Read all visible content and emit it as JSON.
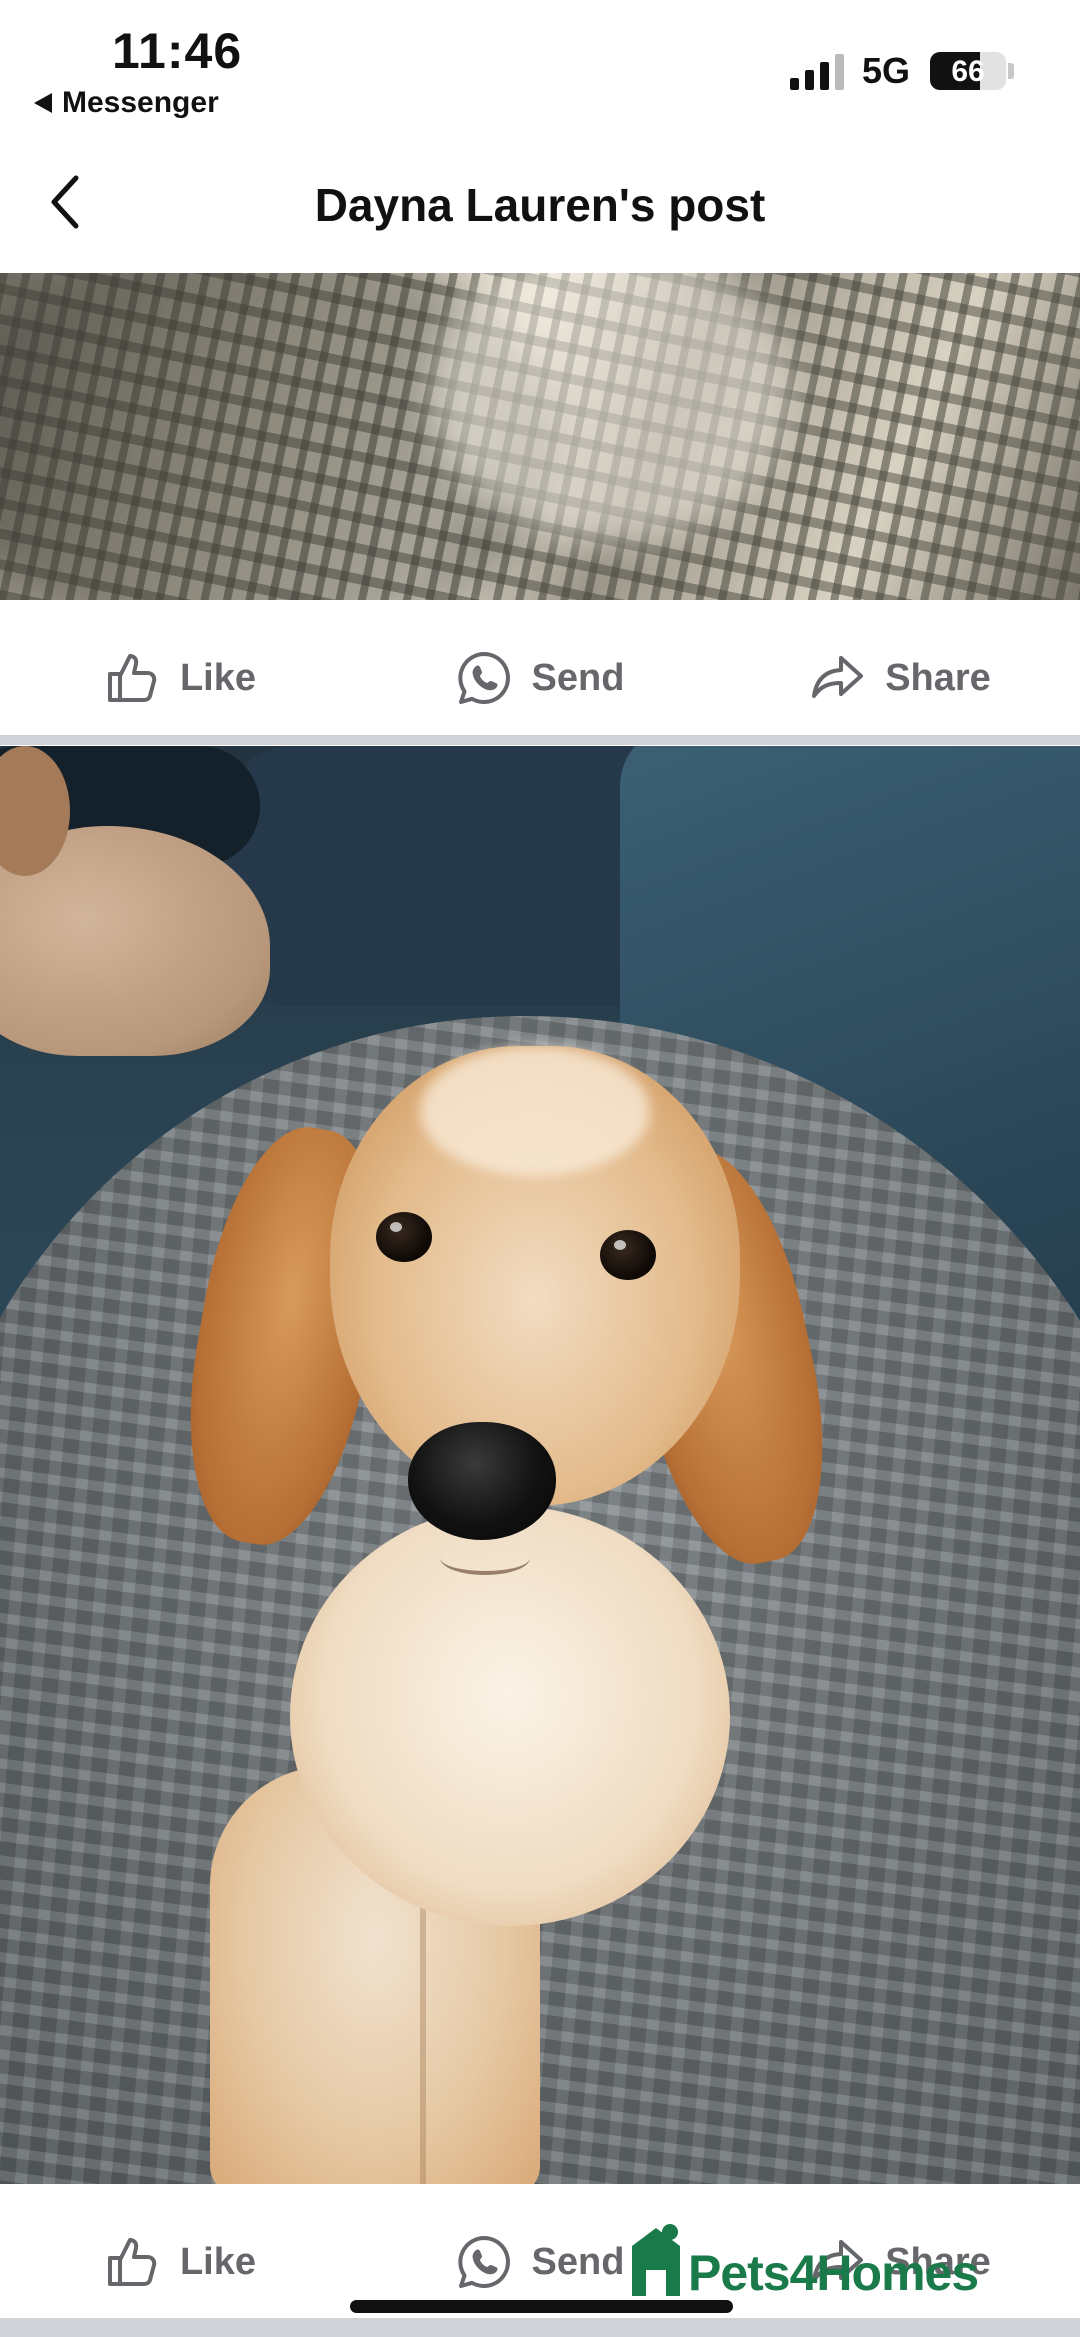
{
  "status_bar": {
    "time": "11:46",
    "back_app": "Messenger",
    "network": "5G",
    "battery_percent": "66",
    "battery_level": 0.66,
    "signal_bars_on": 3
  },
  "nav": {
    "title": "Dayna Lauren's post",
    "back_icon": "chevron-left-icon"
  },
  "actions_top": {
    "like": "Like",
    "send": "Send",
    "share": "Share"
  },
  "actions_bottom": {
    "like": "Like",
    "send": "Send",
    "share": "Share"
  },
  "watermark": {
    "text": "Pets4Homes",
    "color": "#1a7a4a"
  },
  "colors": {
    "action_text": "#65676b",
    "separator": "#cfd2d6"
  }
}
